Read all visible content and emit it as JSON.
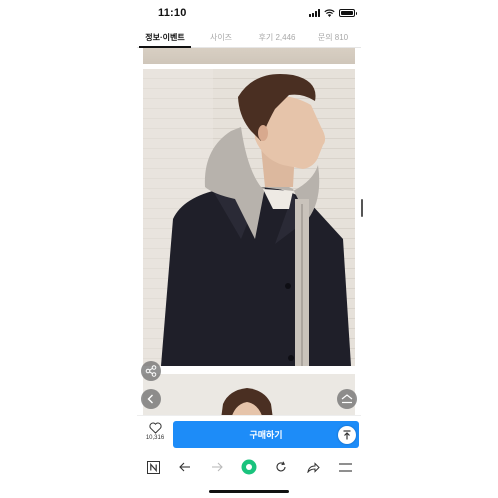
{
  "status": {
    "time": "11:10"
  },
  "tabs": [
    {
      "label": "정보·이벤트",
      "active": true
    },
    {
      "label": "사이즈",
      "active": false
    },
    {
      "label": "후기 2,446",
      "active": false
    },
    {
      "label": "문의 810",
      "active": false
    }
  ],
  "product": {
    "image": "model-wearing-navy-coat-with-grey-hood"
  },
  "buy_bar": {
    "wish_count": "10,316",
    "buy_label": "구매하기"
  },
  "colors": {
    "accent": "#1d8cf8",
    "coat": "#1f1f29",
    "hood": "#b7b2ac"
  },
  "icons": [
    "share-icon",
    "back-arrow-icon",
    "scroll-up-icon",
    "heart-icon",
    "to-top-icon",
    "naver-icon",
    "back-icon",
    "forward-icon",
    "green-dot-icon",
    "refresh-icon",
    "share-arrow-icon",
    "menu-icon"
  ]
}
